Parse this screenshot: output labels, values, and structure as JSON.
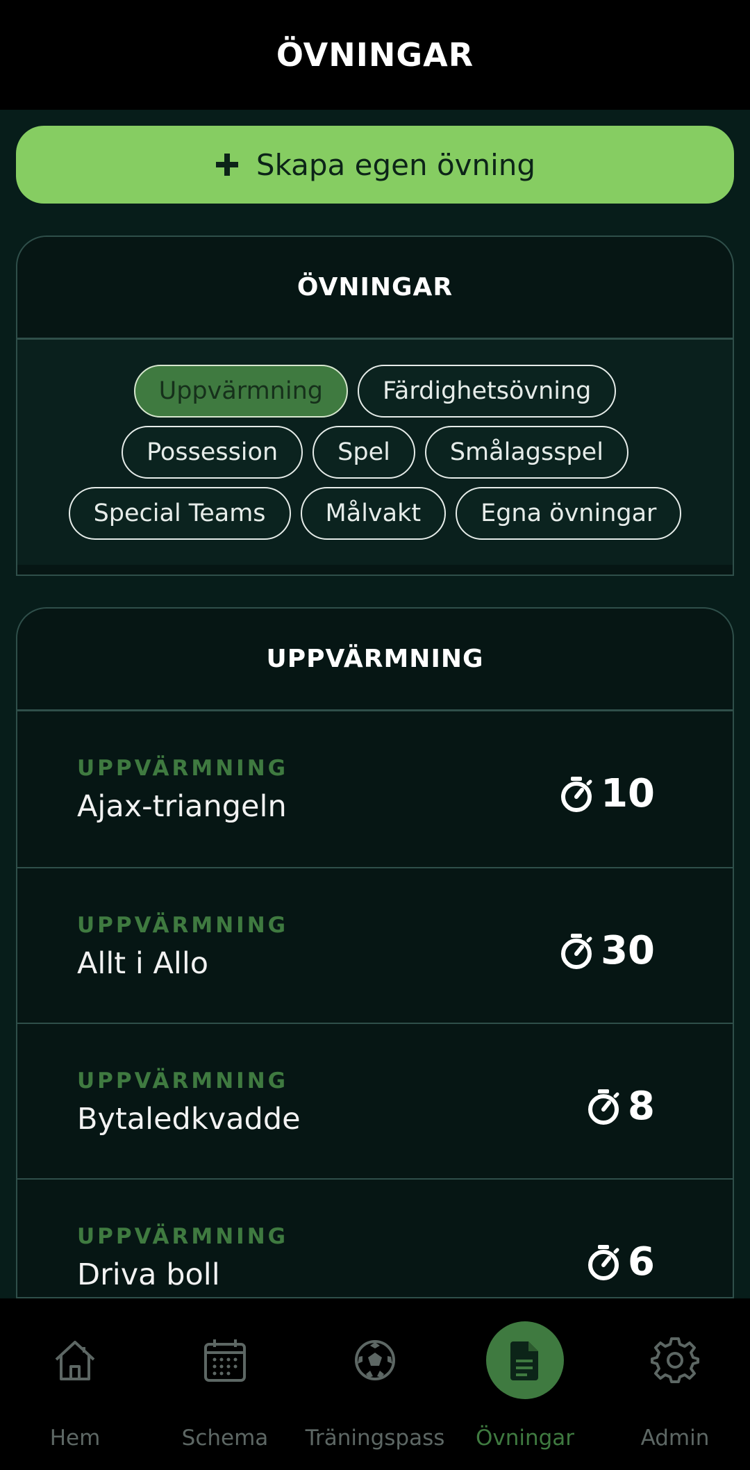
{
  "header": {
    "title": "ÖVNINGAR"
  },
  "create_button": {
    "label": "Skapa egen övning"
  },
  "filters_card": {
    "title": "ÖVNINGAR",
    "chips": [
      {
        "label": "Uppvärmning",
        "active": true
      },
      {
        "label": "Färdighetsövning",
        "active": false
      },
      {
        "label": "Possession",
        "active": false
      },
      {
        "label": "Spel",
        "active": false
      },
      {
        "label": "Smålagsspel",
        "active": false
      },
      {
        "label": "Special Teams",
        "active": false
      },
      {
        "label": "Målvakt",
        "active": false
      },
      {
        "label": "Egna övningar",
        "active": false
      }
    ]
  },
  "exercises_card": {
    "title": "UPPVÄRMNING",
    "items": [
      {
        "category": "UPPVÄRMNING",
        "name": "Ajax-triangeln",
        "minutes": "10"
      },
      {
        "category": "UPPVÄRMNING",
        "name": "Allt i Allo",
        "minutes": "30"
      },
      {
        "category": "UPPVÄRMNING",
        "name": "Bytaledkvadde",
        "minutes": "8"
      },
      {
        "category": "UPPVÄRMNING",
        "name": "Driva boll",
        "minutes": "6"
      }
    ]
  },
  "nav": {
    "items": [
      {
        "label": "Hem",
        "icon": "home-icon"
      },
      {
        "label": "Schema",
        "icon": "calendar-icon"
      },
      {
        "label": "Träningspass",
        "icon": "soccer-ball-icon"
      },
      {
        "label": "Övningar",
        "icon": "document-icon",
        "active": true
      },
      {
        "label": "Admin",
        "icon": "gear-icon"
      }
    ]
  },
  "colors": {
    "accent": "#86cd62",
    "accent_dark": "#3f7a40",
    "background": "#071d1a",
    "bar": "#000000"
  }
}
